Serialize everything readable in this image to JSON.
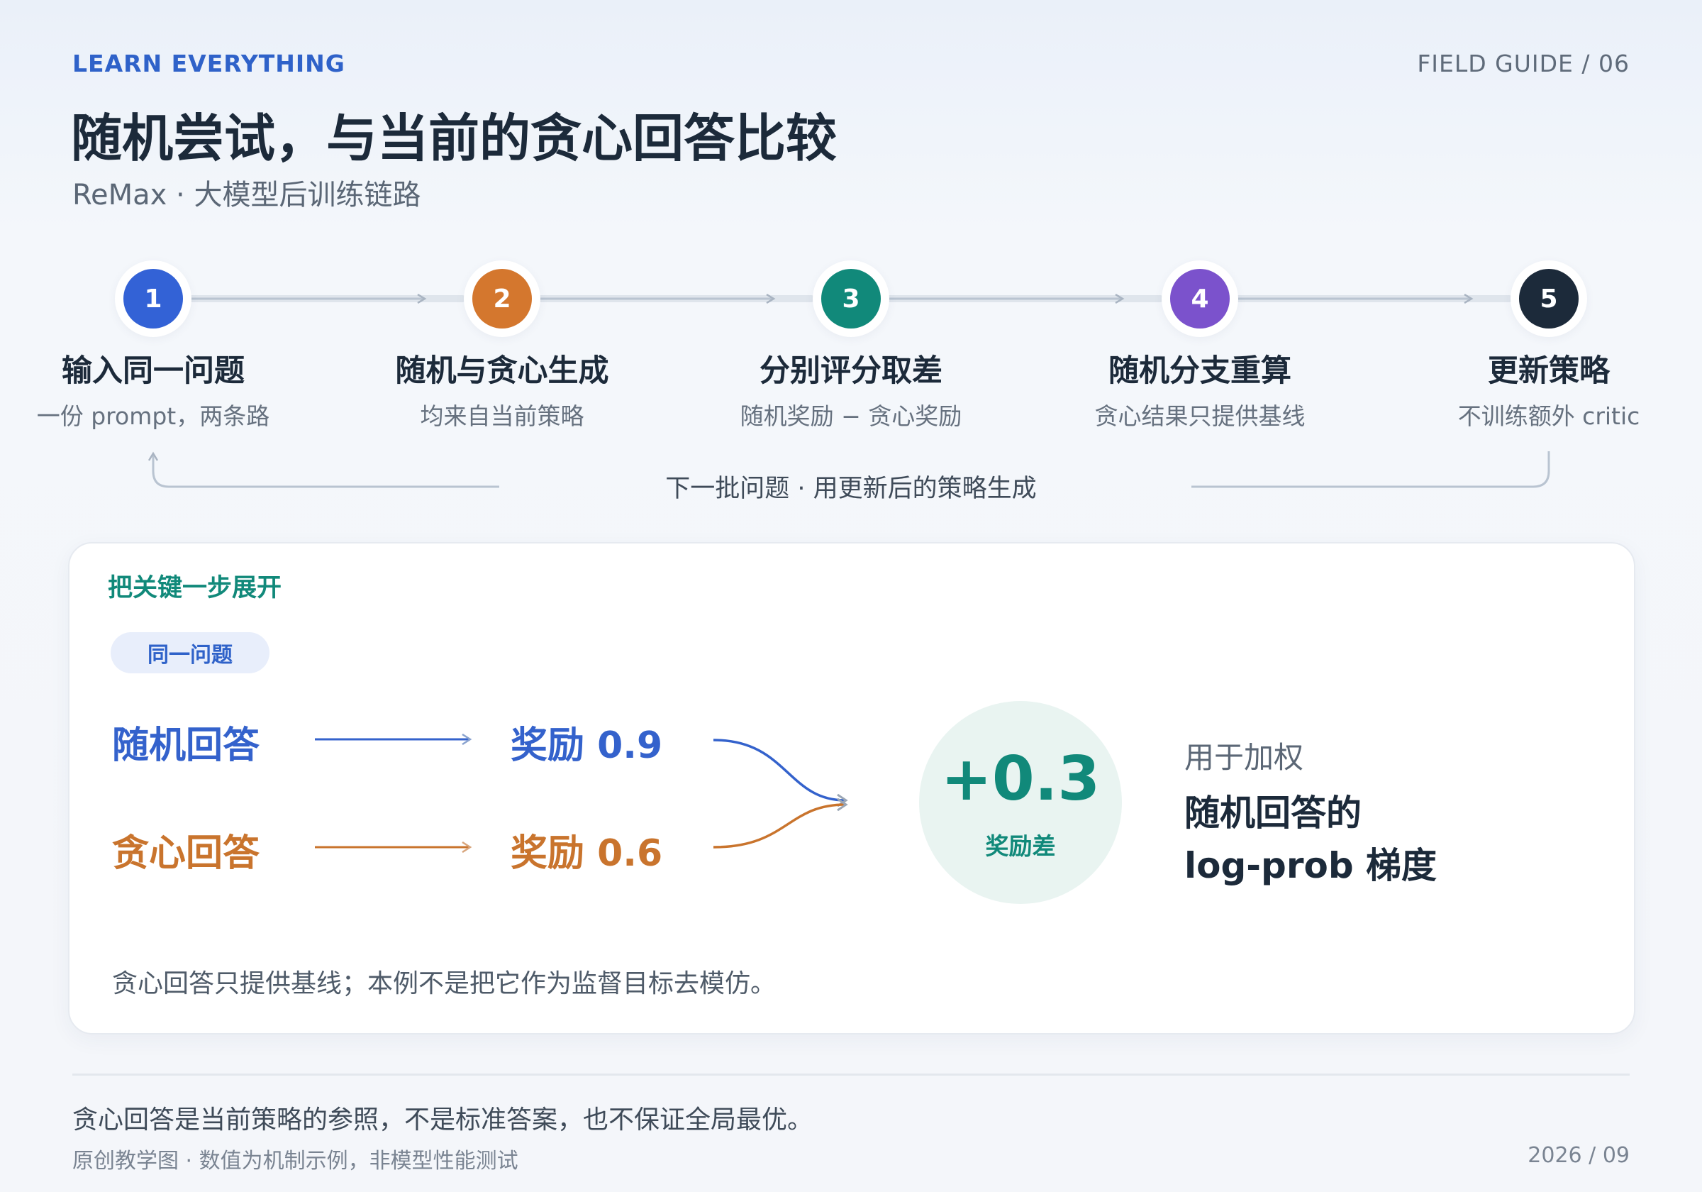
{
  "header": {
    "eyebrow": "LEARN EVERYTHING",
    "guide": "FIELD GUIDE / 06",
    "title": "随机尝试，与当前的贪心回答比较",
    "subtitle": "ReMax · 大模型后训练链路"
  },
  "steps": [
    {
      "number": "1",
      "title": "输入同一问题",
      "subtitle": "一份 prompt，两条路",
      "color": "#3362d6"
    },
    {
      "number": "2",
      "title": "随机与贪心生成",
      "subtitle": "均来自当前策略",
      "color": "#d4772e"
    },
    {
      "number": "3",
      "title": "分别评分取差",
      "subtitle": "随机奖励 − 贪心奖励",
      "color": "#11897a"
    },
    {
      "number": "4",
      "title": "随机分支重算",
      "subtitle": "贪心结果只提供基线",
      "color": "#7b52cc"
    },
    {
      "number": "5",
      "title": "更新策略",
      "subtitle": "不训练额外 critic",
      "color": "#1c2a3a"
    }
  ],
  "loop_label": "下一批问题 · 用更新后的策略生成",
  "card": {
    "heading": "把关键一步展开",
    "pill": "同一问题",
    "rows": [
      {
        "answer": "随机回答",
        "reward": "奖励 0.9",
        "color": "#3462cc"
      },
      {
        "answer": "贪心回答",
        "reward": "奖励 0.6",
        "color": "#c9742d"
      }
    ],
    "difference": {
      "value": "+0.3",
      "label": "奖励差"
    },
    "usage": {
      "intro": "用于加权",
      "line1": "随机回答的",
      "line2": "log-prob 梯度"
    },
    "note": "贪心回答只提供基线；本例不是把它作为监督目标去模仿。"
  },
  "footer": {
    "main": "贪心回答是当前策略的参照，不是标准答案，也不保证全局最优。",
    "sub": "原创教学图 · 数值为机制示例，非模型性能测试",
    "date": "2026 / 09"
  }
}
